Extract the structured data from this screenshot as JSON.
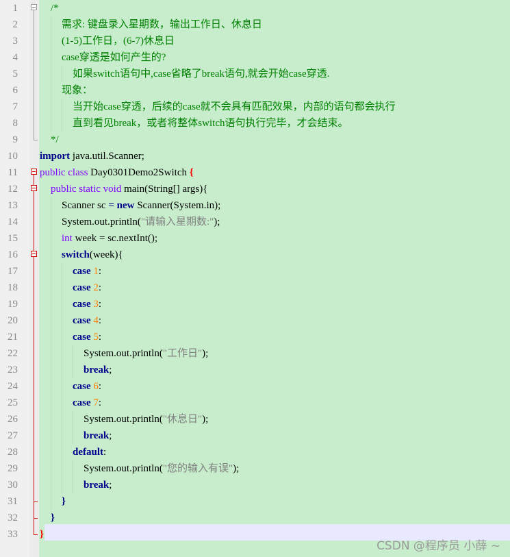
{
  "editor": {
    "line_numbers": [
      "1",
      "2",
      "3",
      "4",
      "5",
      "6",
      "7",
      "8",
      "9",
      "10",
      "11",
      "12",
      "13",
      "14",
      "15",
      "16",
      "17",
      "18",
      "19",
      "20",
      "21",
      "22",
      "23",
      "24",
      "25",
      "26",
      "27",
      "28",
      "29",
      "30",
      "31",
      "32",
      "33"
    ],
    "code": {
      "l1": "/*",
      "l2": "需求: 键盘录入星期数，输出工作日、休息日",
      "l3": "(1-5)工作日，(6-7)休息日",
      "l4": "case穿透是如何产生的?",
      "l5": "如果switch语句中,case省略了break语句,就会开始case穿透.",
      "l6": "现象：",
      "l7": "当开始case穿透，后续的case就不会具有匹配效果，内部的语句都会执行",
      "l8": "直到看见break，或者将整体switch语句执行完毕，才会结束。",
      "l9": "*/",
      "l10": {
        "kw": "import",
        "rest": " java.util.Scanner;"
      },
      "l11": {
        "mod": "public class",
        "name": " Day0301Demo2Switch ",
        "brace": "{"
      },
      "l12": {
        "mod": "public static void",
        "rest": " main(String[] args){"
      },
      "l13": {
        "a": "Scanner sc ",
        "op1": "=",
        "sp": " ",
        "kw": "new",
        "b": " Scanner(System.in);"
      },
      "l14": {
        "a": "System.out.println(",
        "str": "\"请输入星期数:\"",
        "b": ");"
      },
      "l15": {
        "mod": "int",
        "rest": " week = sc.nextInt();"
      },
      "l16": {
        "kw": "switch",
        "rest": "(week){"
      },
      "l17": {
        "kw": "case",
        "num": " 1",
        "rest": ":"
      },
      "l18": {
        "kw": "case",
        "num": " 2",
        "rest": ":"
      },
      "l19": {
        "kw": "case",
        "num": " 3",
        "rest": ":"
      },
      "l20": {
        "kw": "case",
        "num": " 4",
        "rest": ":"
      },
      "l21": {
        "kw": "case",
        "num": " 5",
        "rest": ":"
      },
      "l22": {
        "a": "System.out.println(",
        "str": "\"工作日\"",
        "b": ");"
      },
      "l23": {
        "kw": "break",
        "rest": ";"
      },
      "l24": {
        "kw": "case",
        "num": " 6",
        "rest": ":"
      },
      "l25": {
        "kw": "case",
        "num": " 7",
        "rest": ":"
      },
      "l26": {
        "a": "System.out.println(",
        "str": "\"休息日\"",
        "b": ");"
      },
      "l27": {
        "kw": "break",
        "rest": ";"
      },
      "l28": {
        "kw": "default",
        "rest": ":"
      },
      "l29": {
        "a": "System.out.println(",
        "str": "\"您的输入有误\"",
        "b": ");"
      },
      "l30": {
        "kw": "break",
        "rest": ";"
      },
      "l31": "}",
      "l32": "}",
      "l33": "}"
    }
  },
  "watermark": "CSDN @程序员 小薛 ~",
  "colors": {
    "background": "#c7edcc",
    "comment": "#008000",
    "keyword": "#00008b",
    "modifier": "#8000ff",
    "number": "#ff8000",
    "string": "#808080",
    "fold_marker": "#d00000"
  }
}
